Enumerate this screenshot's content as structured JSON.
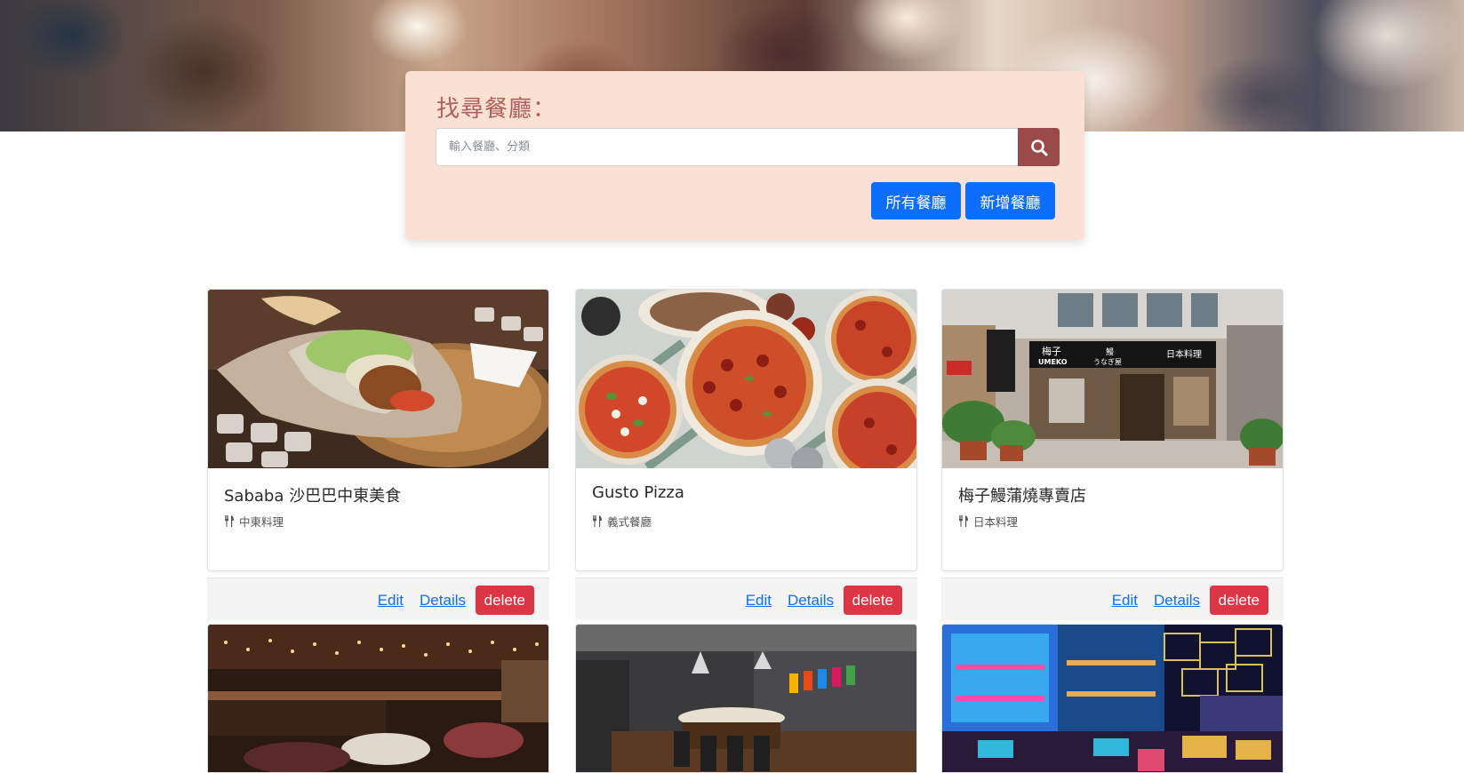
{
  "search": {
    "title": "找尋餐廳：",
    "placeholder": "輸入餐廳、分類",
    "all_label": "所有餐廳",
    "new_label": "新增餐廳"
  },
  "restaurants": [
    {
      "name": "Sababa 沙巴巴中東美食",
      "category": "中東料理"
    },
    {
      "name": "Gusto Pizza",
      "category": "義式餐廳"
    },
    {
      "name": "梅子鰻蒲燒專賣店",
      "category": "日本料理"
    }
  ],
  "actions": {
    "edit_label": "Edit",
    "details_label": "Details",
    "delete_label": "delete"
  },
  "storefront_sign": {
    "name": "梅子",
    "latin": "UMEKO",
    "kana": "うなぎ屋",
    "type": "日本料理",
    "eel": "鰻"
  },
  "colors": {
    "panel_bg": "#fbe1d3",
    "title_color": "#b0605a",
    "search_button": "#9b4a4a",
    "primary": "#0d6efd",
    "danger": "#dc3545"
  }
}
